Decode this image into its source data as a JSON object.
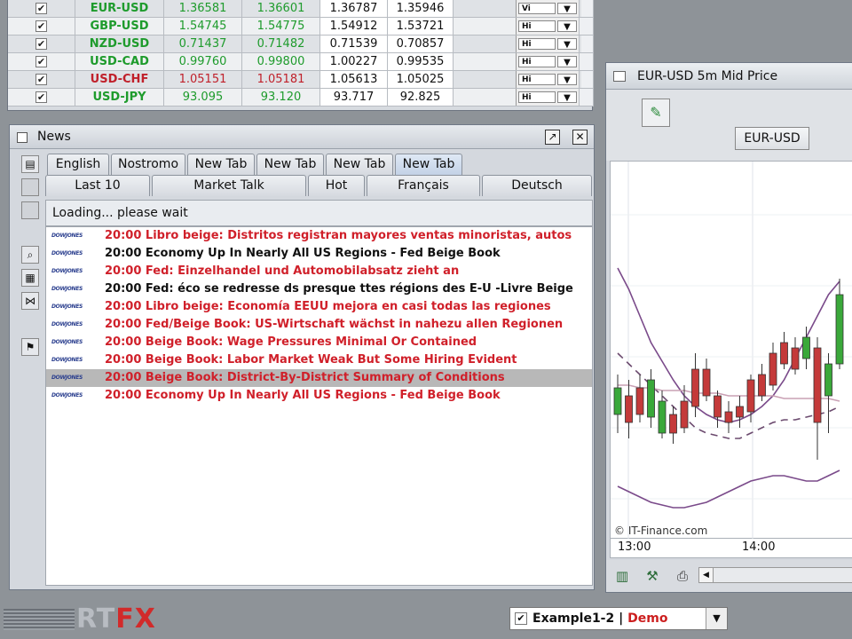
{
  "quotes": {
    "rows": [
      {
        "symbol": "EUR-USD",
        "bid": "1.36581",
        "ask": "1.36601",
        "high": "1.36787",
        "low": "1.35946",
        "sel": "Vi",
        "color": "green"
      },
      {
        "symbol": "GBP-USD",
        "bid": "1.54745",
        "ask": "1.54775",
        "high": "1.54912",
        "low": "1.53721",
        "sel": "Hi",
        "color": "green"
      },
      {
        "symbol": "NZD-USD",
        "bid": "0.71437",
        "ask": "0.71482",
        "high": "0.71539",
        "low": "0.70857",
        "sel": "Hi",
        "color": "green"
      },
      {
        "symbol": "USD-CAD",
        "bid": "0.99760",
        "ask": "0.99800",
        "high": "1.00227",
        "low": "0.99535",
        "sel": "Hi",
        "color": "green"
      },
      {
        "symbol": "USD-CHF",
        "bid": "1.05151",
        "ask": "1.05181",
        "high": "1.05613",
        "low": "1.05025",
        "sel": "Hi",
        "color": "red"
      },
      {
        "symbol": "USD-JPY",
        "bid": "93.095",
        "ask": "93.120",
        "high": "93.717",
        "low": "92.825",
        "sel": "Hi",
        "color": "green"
      }
    ],
    "check_mark": "✔",
    "dropdown_arrow": "▼"
  },
  "news": {
    "title": "News",
    "float_btn": "↗",
    "close_btn": "✕",
    "tabs_top": [
      "English",
      "Nostromo",
      "New Tab",
      "New Tab",
      "New Tab",
      "New Tab"
    ],
    "tabs_bottom": [
      "Last 10",
      "Market Talk",
      "Hot",
      "Français",
      "Deutsch"
    ],
    "status": "Loading... please wait",
    "source_label": "DOWJONES",
    "items": [
      {
        "time": "20:00",
        "text": "Libro beige: Distritos registran mayores ventas minoristas, autos",
        "color": "#d0202a"
      },
      {
        "time": "20:00",
        "text": "Economy Up In Nearly All US Regions - Fed Beige Book",
        "color": "#111111"
      },
      {
        "time": "20:00",
        "text": "Fed: Einzelhandel und Automobilabsatz zieht an",
        "color": "#d0202a"
      },
      {
        "time": "20:00",
        "text": "Fed: éco se redresse ds presque ttes régions des E-U -Livre Beige",
        "color": "#111111"
      },
      {
        "time": "20:00",
        "text": "Libro beige: Economía EEUU mejora en casi todas las regiones",
        "color": "#d0202a"
      },
      {
        "time": "20:00",
        "text": "Fed/Beige Book: US-Wirtschaft wächst in nahezu allen Regionen",
        "color": "#d0202a"
      },
      {
        "time": "20:00",
        "text": "Beige Book: Wage Pressures Minimal Or Contained",
        "color": "#d0202a"
      },
      {
        "time": "20:00",
        "text": "Beige Book: Labor Market Weak But Some Hiring Evident",
        "color": "#d0202a"
      },
      {
        "time": "20:00",
        "text": "Beige Book: District-By-District Summary of Conditions",
        "color": "#d0202a",
        "selected": true
      },
      {
        "time": "20:00",
        "text": "Economy Up In Nearly All US Regions - Fed Beige Book",
        "color": "#d0202a"
      }
    ]
  },
  "chart": {
    "title": "EUR-USD 5m Mid Price",
    "symbol": "EUR-USD",
    "watermark": "© IT-Finance.com",
    "x_ticks": [
      "13:00",
      "14:00"
    ],
    "bull_color": "#3aa83a",
    "bear_color": "#c43a3a",
    "band_color": "#7a4a8a",
    "candles": [
      {
        "o": 0.55,
        "c": 0.45,
        "h": 0.4,
        "l": 0.62
      },
      {
        "o": 0.48,
        "c": 0.58,
        "h": 0.42,
        "l": 0.64
      },
      {
        "o": 0.45,
        "c": 0.55,
        "h": 0.4,
        "l": 0.58
      },
      {
        "o": 0.56,
        "c": 0.42,
        "h": 0.38,
        "l": 0.6
      },
      {
        "o": 0.62,
        "c": 0.5,
        "h": 0.46,
        "l": 0.64
      },
      {
        "o": 0.55,
        "c": 0.62,
        "h": 0.52,
        "l": 0.66
      },
      {
        "o": 0.5,
        "c": 0.6,
        "h": 0.44,
        "l": 0.62
      },
      {
        "o": 0.38,
        "c": 0.52,
        "h": 0.32,
        "l": 0.56
      },
      {
        "o": 0.38,
        "c": 0.48,
        "h": 0.34,
        "l": 0.5
      },
      {
        "o": 0.48,
        "c": 0.56,
        "h": 0.46,
        "l": 0.6
      },
      {
        "o": 0.54,
        "c": 0.58,
        "h": 0.5,
        "l": 0.62
      },
      {
        "o": 0.52,
        "c": 0.56,
        "h": 0.48,
        "l": 0.6
      },
      {
        "o": 0.42,
        "c": 0.54,
        "h": 0.4,
        "l": 0.58
      },
      {
        "o": 0.4,
        "c": 0.48,
        "h": 0.36,
        "l": 0.5
      },
      {
        "o": 0.32,
        "c": 0.44,
        "h": 0.28,
        "l": 0.46
      },
      {
        "o": 0.28,
        "c": 0.36,
        "h": 0.24,
        "l": 0.38
      },
      {
        "o": 0.3,
        "c": 0.38,
        "h": 0.26,
        "l": 0.4
      },
      {
        "o": 0.34,
        "c": 0.26,
        "h": 0.22,
        "l": 0.38
      },
      {
        "o": 0.3,
        "c": 0.58,
        "h": 0.26,
        "l": 0.72
      },
      {
        "o": 0.48,
        "c": 0.36,
        "h": 0.32,
        "l": 0.62
      },
      {
        "o": 0.36,
        "c": 0.1,
        "h": 0.04,
        "l": 0.38
      }
    ],
    "band_upper": [
      0.0,
      0.08,
      0.18,
      0.28,
      0.35,
      0.42,
      0.48,
      0.52,
      0.55,
      0.57,
      0.58,
      0.57,
      0.55,
      0.52,
      0.48,
      0.42,
      0.34,
      0.26,
      0.18,
      0.1,
      0.05
    ],
    "band_lower": [
      0.82,
      0.84,
      0.86,
      0.88,
      0.89,
      0.9,
      0.9,
      0.89,
      0.88,
      0.86,
      0.84,
      0.82,
      0.8,
      0.79,
      0.78,
      0.78,
      0.79,
      0.8,
      0.8,
      0.78,
      0.76
    ],
    "band_mid": [
      0.32,
      0.36,
      0.4,
      0.44,
      0.48,
      0.52,
      0.56,
      0.6,
      0.62,
      0.63,
      0.64,
      0.64,
      0.62,
      0.6,
      0.58,
      0.57,
      0.57,
      0.56,
      0.55,
      0.54,
      0.52
    ],
    "flat_line": [
      0.44,
      0.44,
      0.45,
      0.45,
      0.46,
      0.46,
      0.46,
      0.47,
      0.47,
      0.47,
      0.48,
      0.48,
      0.48,
      0.48,
      0.48,
      0.49,
      0.49,
      0.49,
      0.49,
      0.49,
      0.5
    ],
    "icons": [
      "bar-chart-icon",
      "indicators-icon",
      "print-icon"
    ]
  },
  "footer": {
    "logo_rt": "RT",
    "logo_fx": "FX",
    "profile_name": "Example1-2",
    "profile_sep": " | ",
    "profile_mode": "Demo"
  }
}
